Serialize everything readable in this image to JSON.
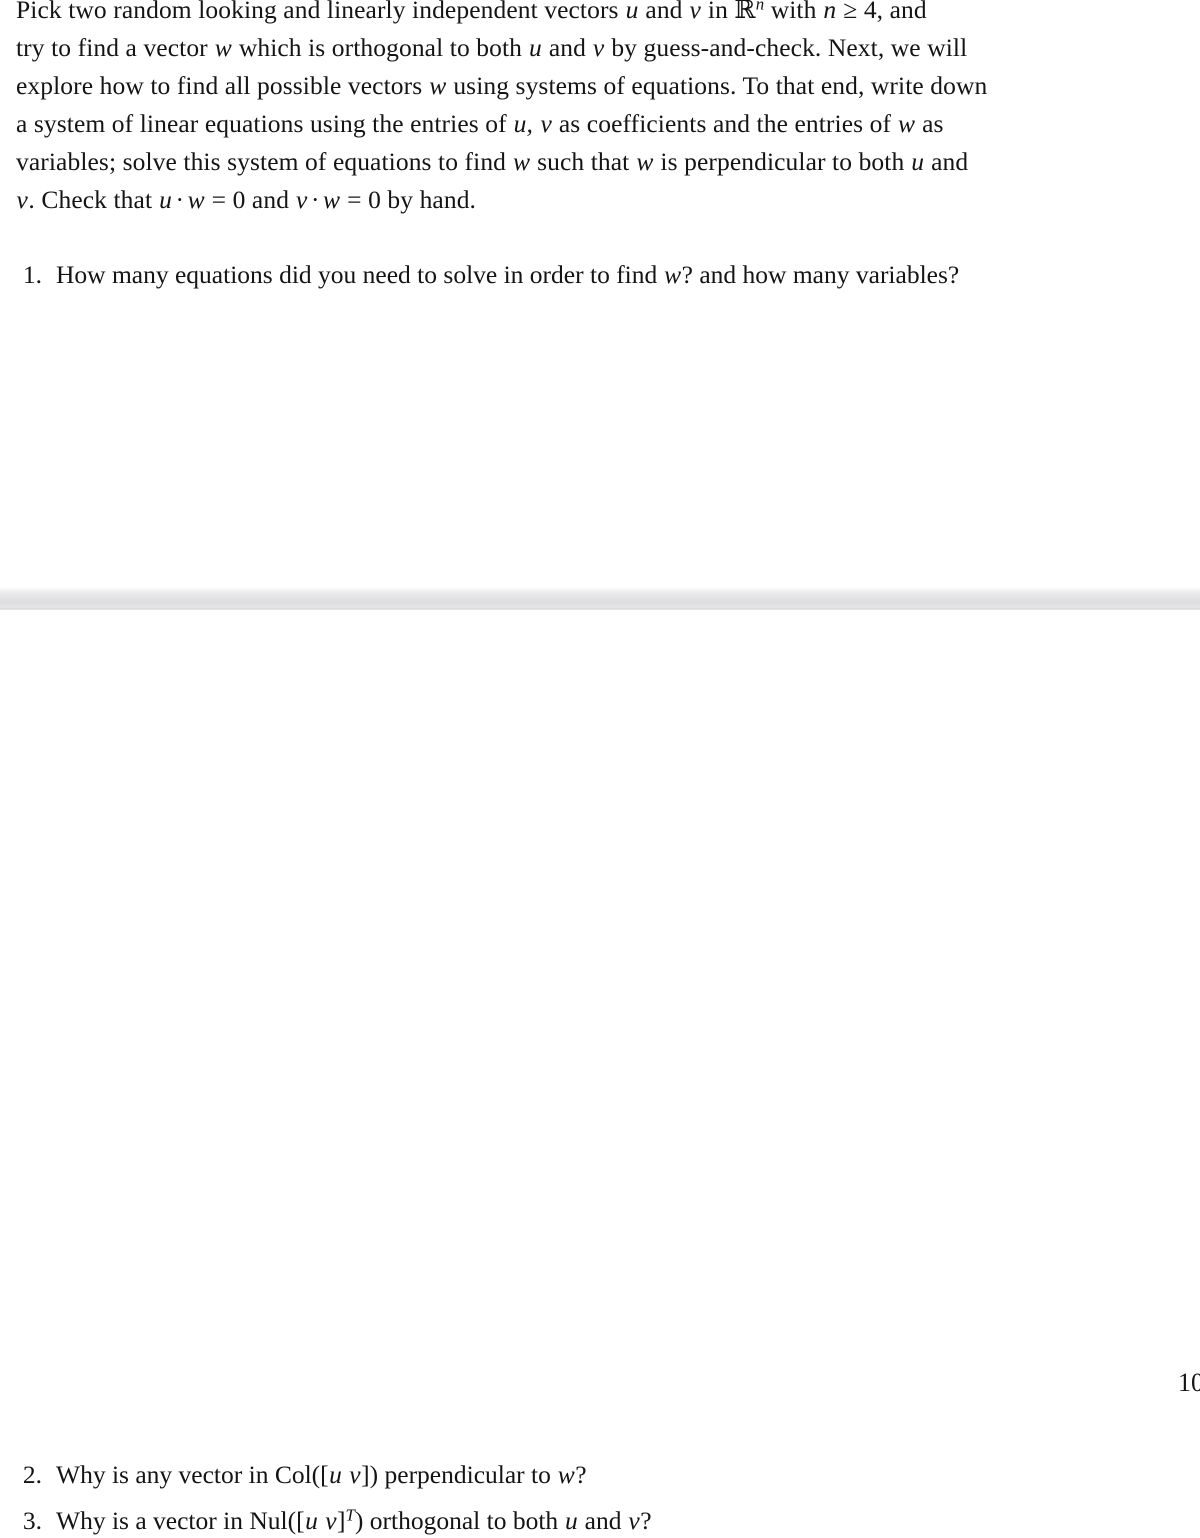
{
  "document": {
    "page_number": "10",
    "intro_paragraph": {
      "lines": [
        "Pick two random looking and linearly independent vectors u and v in ℝⁿ with n ≥ 4, and",
        "try to find a vector w which is orthogonal to both u and v by guess-and-check. Next, we will",
        "explore how to find all possible vectors w using systems of equations. To that end, write down",
        "a system of linear equations using the entries of u, v as coefficients and the entries of w as",
        "variables; solve this system of equations to find w such that w is perpendicular to both u and",
        "v. Check that u · w = 0 and v · w = 0 by hand."
      ],
      "line_1": {
        "seg_a": "Pick two random looking and linearly independent vectors ",
        "var_u": "u",
        "seg_b": " and ",
        "var_v": "v",
        "seg_c": " in ",
        "set_r": "ℝ",
        "sup_n": "n",
        "seg_d": " with ",
        "var_n": "n",
        "seg_e": " ≥ 4, and"
      },
      "line_2": {
        "seg_a": "try to find a vector ",
        "var_w": "w",
        "seg_b": " which is orthogonal to both ",
        "var_u": "u",
        "seg_c": " and ",
        "var_v": "v",
        "seg_d": " by guess-and-check. Next, we will"
      },
      "line_3": {
        "seg_a": "explore how to find all possible vectors ",
        "var_w": "w",
        "seg_b": " using systems of equations. To that end, write down"
      },
      "line_4": {
        "seg_a": "a system of linear equations using the entries of ",
        "var_u": "u,",
        "var_v": "v",
        "seg_b": " as coefficients and the entries of ",
        "var_w": "w",
        "seg_c": " as"
      },
      "line_5": {
        "seg_a": "variables; solve this system of equations to find ",
        "var_w": "w",
        "seg_b": " such that ",
        "var_w2": "w",
        "seg_c": " is perpendicular to both ",
        "var_u": "u",
        "seg_d": " and"
      },
      "line_6": {
        "var_v": "v",
        "seg_a": ". Check that ",
        "var_u": "u",
        "dot1": "·",
        "var_w": "w",
        "seg_b": " = 0 and ",
        "var_v2": "v",
        "dot2": "·",
        "var_w2": "w",
        "seg_c": " = 0 by hand."
      }
    },
    "questions": [
      {
        "number": "1.",
        "text": "How many equations did you need to solve in order to find w? and how many variables?",
        "seg_a": "How many equations did you need to solve in order to find ",
        "var_w": "w",
        "seg_b": "? and how many variables?"
      },
      {
        "number": "2.",
        "text": "Why is any vector in Col([u v]) perpendicular to w?",
        "seg_a": "Why is any vector in ",
        "op": "Col(",
        "bracket_open": "[",
        "var_u": "u",
        "var_v": "v",
        "bracket_close": "]",
        "paren_close": ")",
        "seg_b": " perpendicular to ",
        "var_w": "w",
        "seg_c": "?"
      },
      {
        "number": "3.",
        "text": "Why is a vector in Nul([u v]^T) orthogonal to both u and v?",
        "seg_a": "Why is a vector in ",
        "op": "Nul(",
        "bracket_open": "[",
        "var_u": "u",
        "var_v": "v",
        "bracket_close": "]",
        "sup_t": "T",
        "paren_close": ")",
        "seg_b": " orthogonal to both ",
        "var_u2": "u",
        "seg_c": " and ",
        "var_v2": "v",
        "seg_d": "?"
      }
    ]
  },
  "colors": {
    "page_background": "#ffffff",
    "text": "#141414",
    "divider_light": "#f2f2f3",
    "divider_mid": "#e3e3e6",
    "divider_dark": "#d7d7d9"
  }
}
